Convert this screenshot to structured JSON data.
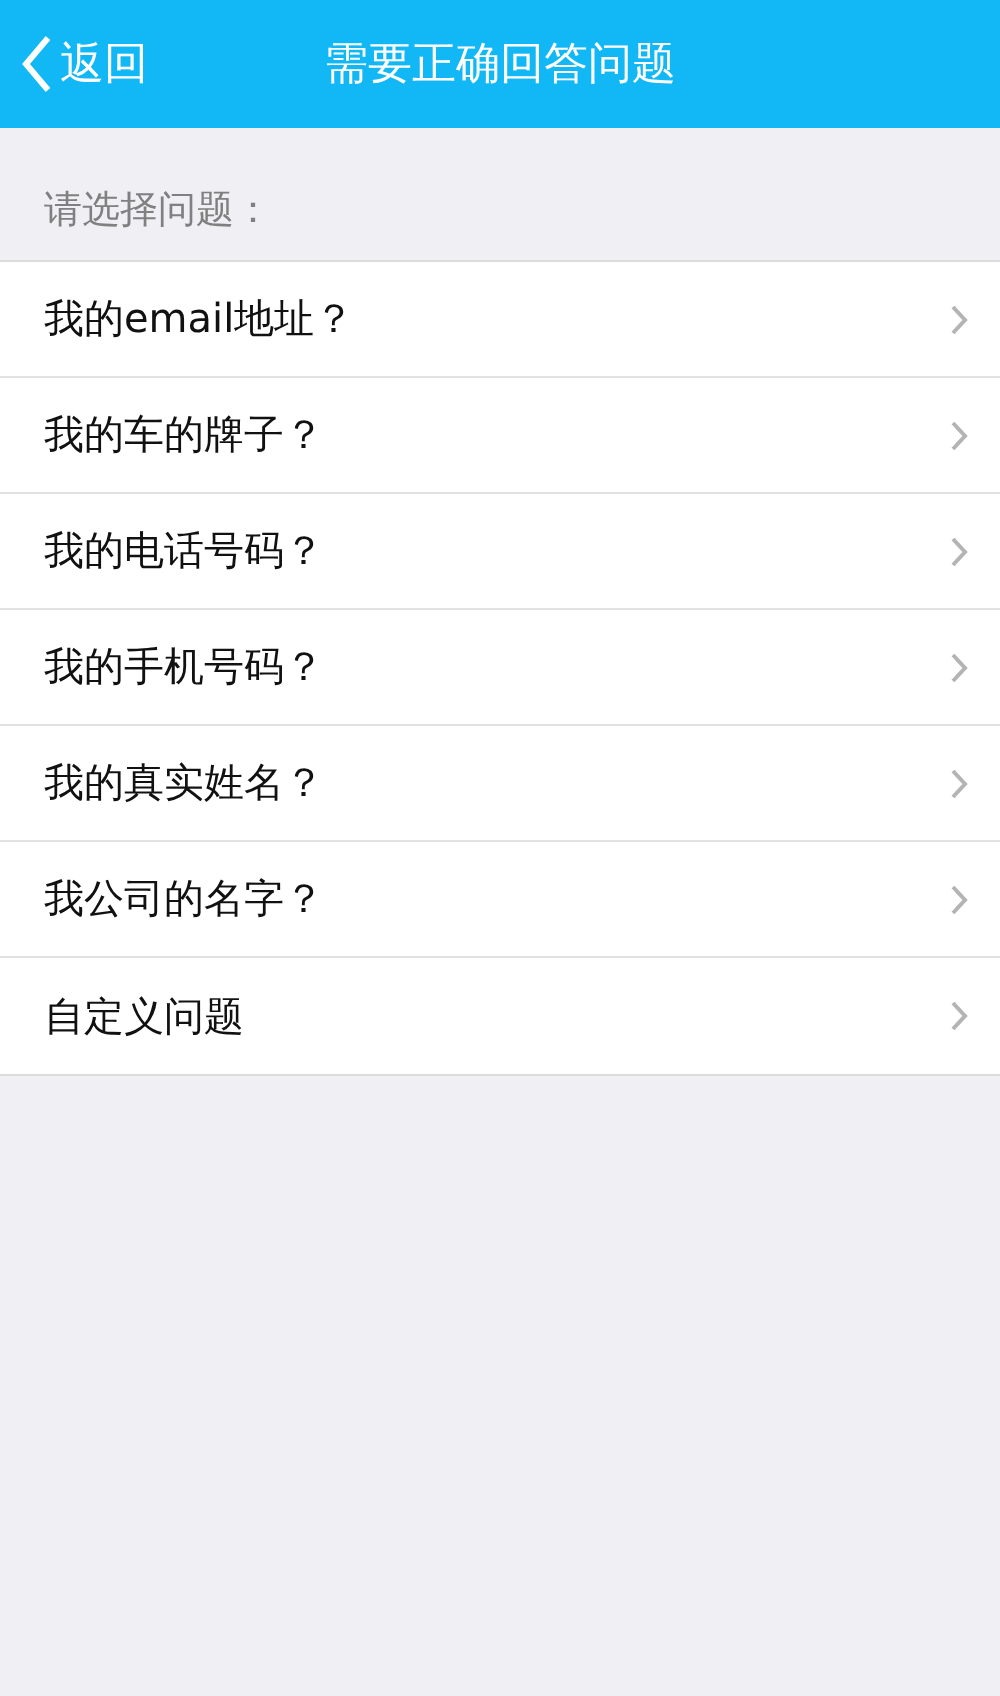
{
  "header": {
    "back_label": "返回",
    "title": "需要正确回答问题"
  },
  "section_label": "请选择问题：",
  "questions": [
    {
      "label": "我的email地址？"
    },
    {
      "label": "我的车的牌子？"
    },
    {
      "label": "我的电话号码？"
    },
    {
      "label": "我的手机号码？"
    },
    {
      "label": "我的真实姓名？"
    },
    {
      "label": "我公司的名字？"
    },
    {
      "label": "自定义问题"
    }
  ]
}
